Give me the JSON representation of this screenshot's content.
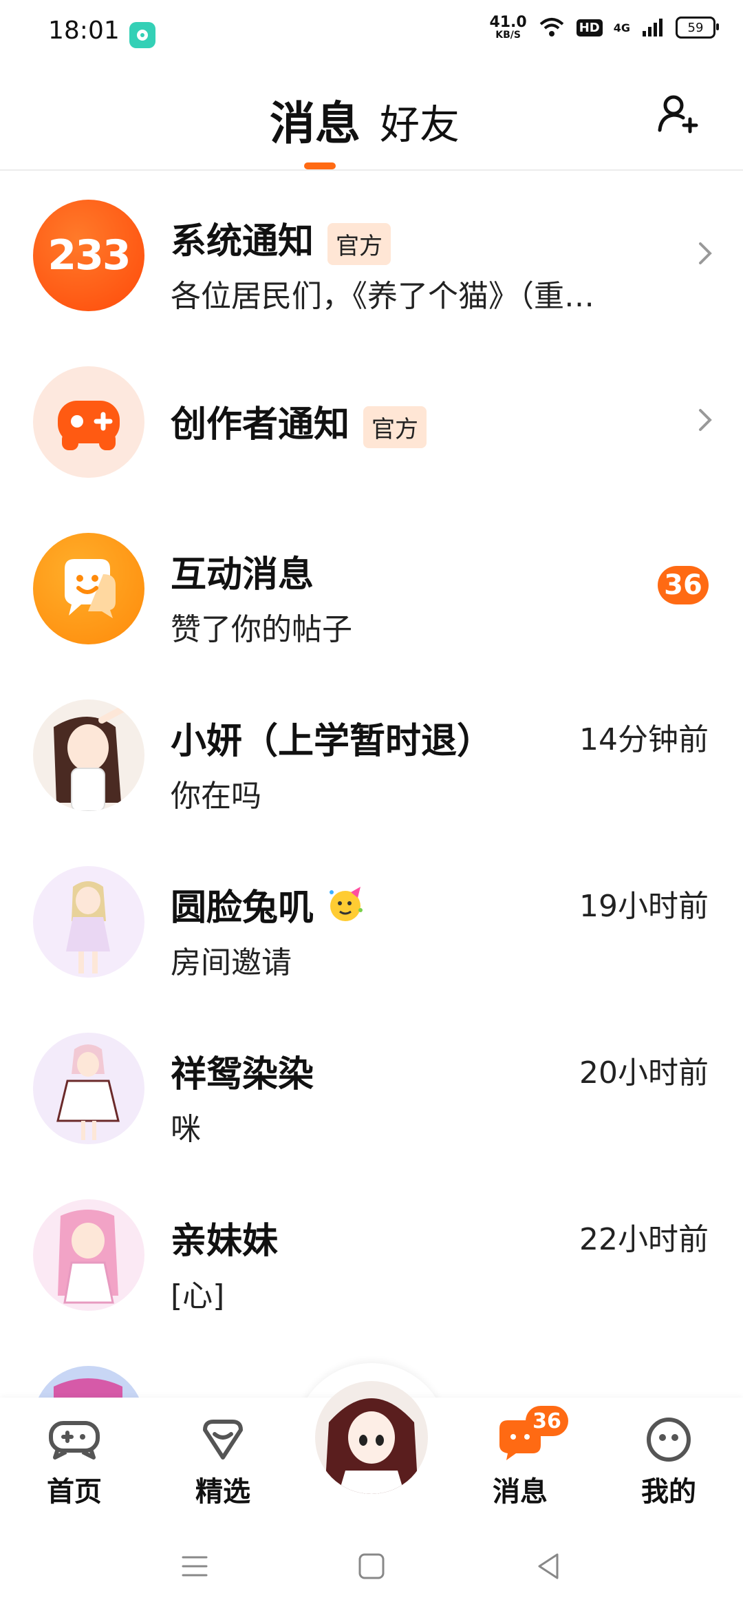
{
  "status_bar": {
    "time": "18:01",
    "net_speed_value": "41.0",
    "net_speed_unit": "KB/S",
    "hd": "HD",
    "network": "4G",
    "battery": "59"
  },
  "header": {
    "tab_messages": "消息",
    "tab_friends": "好友",
    "accent_color": "#ff6a13"
  },
  "conversations": [
    {
      "title": "系统通知",
      "badge": "官方",
      "subtitle": "各位居民们，《养了个猫》（重…"
    },
    {
      "title": "创作者通知",
      "badge": "官方",
      "subtitle": ""
    },
    {
      "title": "互动消息",
      "subtitle": "赞了你的帖子",
      "unread": "36"
    },
    {
      "title": "小妍（上学暂时退）",
      "subtitle": "你在吗",
      "time": "14分钟前"
    },
    {
      "title": "圆脸兔叽",
      "subtitle": "房间邀请",
      "time": "19小时前"
    },
    {
      "title": "祥鸳染染",
      "subtitle": "咪",
      "time": "20小时前"
    },
    {
      "title": "亲妹妹",
      "subtitle": "[心]",
      "time": "22小时前"
    }
  ],
  "system_avatar_text": "233",
  "bottom_nav": {
    "home": "首页",
    "featured": "精选",
    "messages": "消息",
    "messages_count": "36",
    "mine": "我的"
  }
}
